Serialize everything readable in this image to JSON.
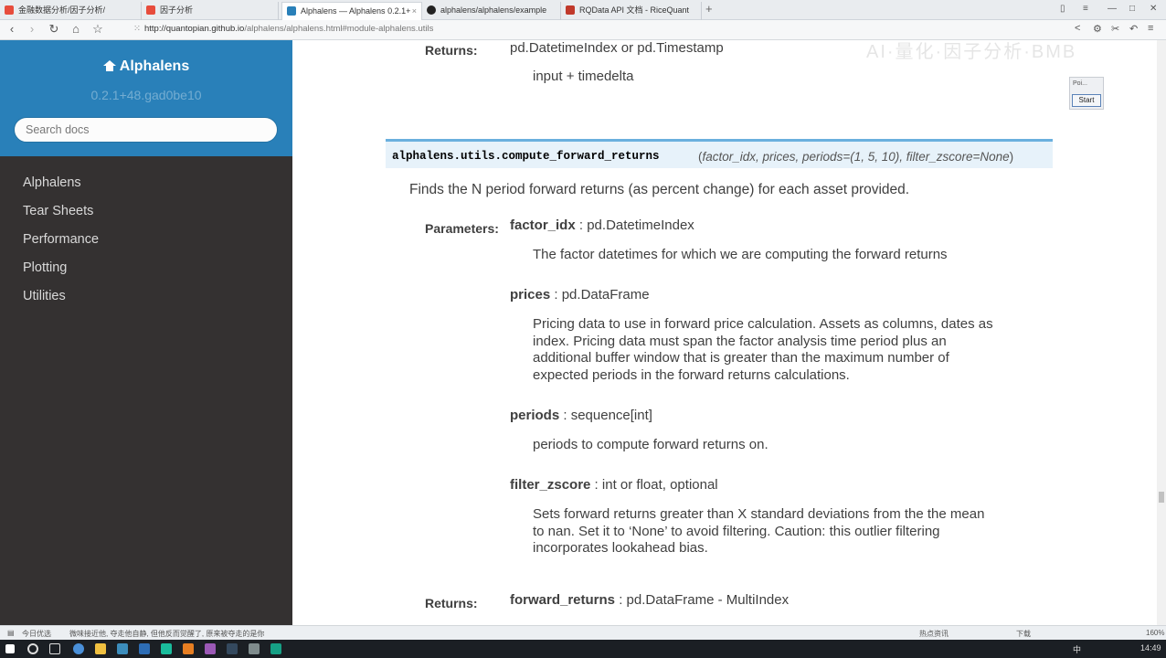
{
  "browser": {
    "tabs": [
      {
        "label": "金融数据分析/因子分析/",
        "color": "#e74c3c"
      },
      {
        "label": "因子分析",
        "color": "#e74c3c"
      },
      {
        "label": "Alphalens — Alphalens 0.2.1+",
        "color": "#2980b9"
      },
      {
        "label": "alphalens/alphalens/example",
        "color": "#222222"
      },
      {
        "label": "RQData API 文档 - RiceQuant",
        "color": "#c0392b"
      }
    ],
    "url_prefix": "http://",
    "url_host": "quantopian.github.io",
    "url_path": "/alphalens/alphalens.html#module-alphalens.utils"
  },
  "sidebar": {
    "title": "Alphalens",
    "version": "0.2.1+48.gad0be10",
    "search_placeholder": "Search docs",
    "items": [
      "Alphalens",
      "Tear Sheets",
      "Performance",
      "Plotting",
      "Utilities"
    ]
  },
  "prev_returns": {
    "label": "Returns:",
    "type": "pd.DatetimeIndex or pd.Timestamp",
    "desc": "input + timedelta"
  },
  "function": {
    "name": "alphalens.utils.compute_forward_returns",
    "args": "factor_idx, prices, periods=(1, 5, 10), filter_zscore=None",
    "open_paren": "(",
    "close_paren": ")",
    "summary": "Finds the N period forward returns (as percent change) for each asset provided.",
    "parameters_label": "Parameters:",
    "params": [
      {
        "name": "factor_idx",
        "sep": " : ",
        "type": "pd.DatetimeIndex",
        "desc": [
          "The factor datetimes for which we are computing the forward returns"
        ]
      },
      {
        "name": "prices",
        "sep": " : ",
        "type": "pd.DataFrame",
        "desc": [
          "Pricing data to use in forward price calculation. Assets as columns, dates as",
          "index. Pricing data must span the factor analysis time period plus an",
          "additional buffer window that is greater than the maximum number of",
          "expected periods in the forward returns calculations."
        ]
      },
      {
        "name": "periods",
        "sep": " : ",
        "type": "sequence[int]",
        "desc": [
          "periods to compute forward returns on."
        ]
      },
      {
        "name": "filter_zscore",
        "sep": " : ",
        "type": "int or float, optional",
        "desc": [
          "Sets forward returns greater than X standard deviations from the the mean",
          "to nan. Set it to ‘None’ to avoid filtering. Caution: this outlier filtering",
          "incorporates lookahead bias."
        ]
      }
    ],
    "returns_label": "Returns:",
    "returns_name": "forward_returns",
    "returns_sep": " : ",
    "returns_type": "pd.DataFrame - MultiIndex"
  },
  "mini_widget": {
    "label": "Poi...",
    "button": "Start"
  },
  "statusbar": {
    "left1": "今日优选",
    "left2": "微味接近他, 夺走他自静, 但他反而觉醒了, 原来被夺走的是你",
    "right1": "热点资讯",
    "right2": "下载",
    "zoom": "160%"
  },
  "taskbar": {
    "time": "14:49",
    "ime": "中"
  }
}
